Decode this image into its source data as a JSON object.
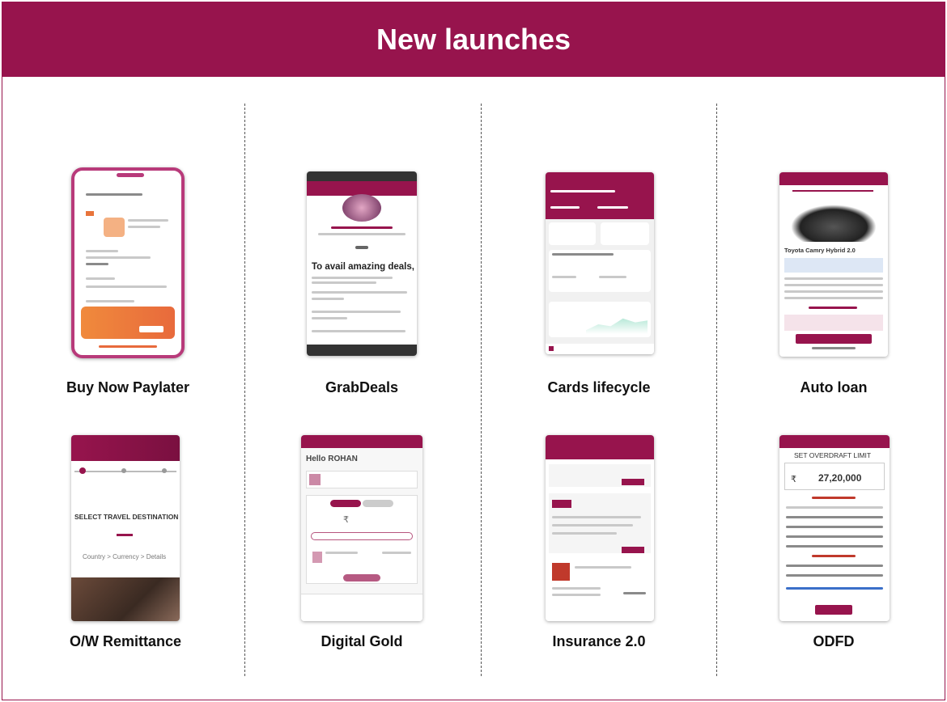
{
  "header": {
    "title": "New launches"
  },
  "launches": [
    {
      "label": "Buy Now Paylater"
    },
    {
      "label": "GrabDeals"
    },
    {
      "label": "Cards lifecycle"
    },
    {
      "label": "Auto loan"
    },
    {
      "label": "O/W Remittance"
    },
    {
      "label": "Digital Gold"
    },
    {
      "label": "Insurance 2.0"
    },
    {
      "label": "ODFD"
    }
  ],
  "screens": {
    "grabdeals_heading": "To avail amazing deals,",
    "auto_loan_car": "Toyota Camry Hybrid 2.0",
    "remit_title": "SELECT TRAVEL DESTINATION",
    "remit_steps": "Country  >  Currency  >  Details",
    "gold_greeting": "Hello ROHAN",
    "odfd_title": "SET OVERDRAFT LIMIT",
    "odfd_amount": "27,20,000",
    "odfd_rupee": "₹",
    "gold_rupee": "₹"
  },
  "colors": {
    "brand": "#97144d",
    "accent": "#e8743b",
    "grid": "#555555"
  }
}
